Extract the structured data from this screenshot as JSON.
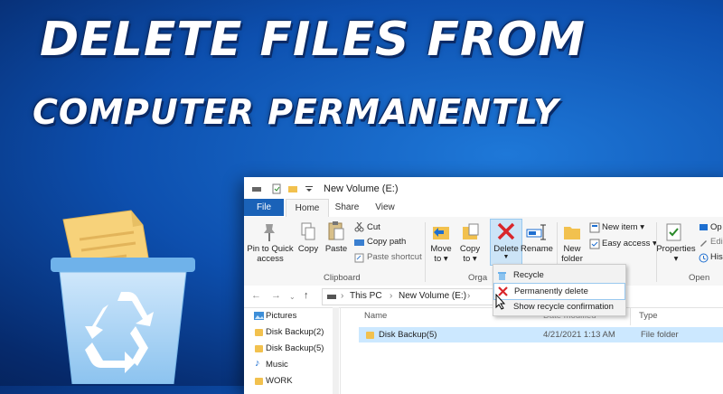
{
  "headline": {
    "line1": "DELETE FILES FROM",
    "line2": "COMPUTER PERMANENTLY"
  },
  "explorer": {
    "title": "New Volume (E:)",
    "tabs": [
      "File",
      "Home",
      "Share",
      "View"
    ],
    "ribbon": {
      "clipboard": {
        "pin_label_1": "Pin to Quick",
        "pin_label_2": "access",
        "copy": "Copy",
        "paste": "Paste",
        "cut": "Cut",
        "copy_path": "Copy path",
        "paste_shortcut": "Paste shortcut",
        "group": "Clipboard"
      },
      "organize": {
        "move_to_1": "Move",
        "move_to_2": "to",
        "copy_to_1": "Copy",
        "copy_to_2": "to",
        "delete": "Delete",
        "rename": "Rename",
        "group": "Orga"
      },
      "new": {
        "new_folder_1": "New",
        "new_folder_2": "folder",
        "new_item": "New item",
        "easy_access": "Easy access"
      },
      "open": {
        "properties": "Properties",
        "open_cut": "Op",
        "edit_cut": "Edi",
        "history_cut": "His",
        "group": "Open"
      }
    },
    "address": {
      "this_pc": "This PC",
      "volume": "New Volume (E:)"
    },
    "nav_pane": [
      "Pictures",
      "Disk Backup(2)",
      "Disk Backup(5)",
      "Music",
      "WORK"
    ],
    "columns": {
      "name": "Name",
      "date": "Date modified",
      "type": "Type"
    },
    "rows": [
      {
        "name": "Disk Backup(5)",
        "date": "4/21/2021 1:13 AM",
        "type": "File folder"
      }
    ],
    "delete_menu": [
      "Recycle",
      "Permanently delete",
      "Show recycle confirmation"
    ]
  },
  "colors": {
    "accent": "#1a62b8",
    "selection": "#cce8ff",
    "folder": "#f2c14e",
    "delete_red": "#d9262b"
  }
}
